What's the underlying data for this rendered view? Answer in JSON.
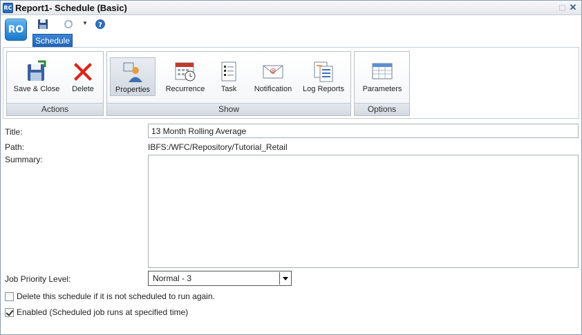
{
  "window": {
    "title": "Report1- Schedule (Basic)",
    "app_icon_text": "RC"
  },
  "quick_access": {
    "logo_text": "RO",
    "tab_label": "Schedule"
  },
  "ribbon": {
    "groups": {
      "actions": {
        "label": "Actions",
        "buttons": {
          "save_close": "Save & Close",
          "delete": "Delete"
        }
      },
      "show": {
        "label": "Show",
        "buttons": {
          "properties": "Properties",
          "recurrence": "Recurrence",
          "task": "Task",
          "notification": "Notification",
          "log_reports": "Log Reports"
        }
      },
      "options": {
        "label": "Options",
        "buttons": {
          "parameters": "Parameters"
        }
      }
    }
  },
  "form": {
    "title_label": "Title:",
    "title_value": "13 Month Rolling Average",
    "path_label": "Path:",
    "path_value": "IBFS:/WFC/Repository/Tutorial_Retail",
    "summary_label": "Summary:",
    "summary_value": "",
    "priority_label": "Job Priority Level:",
    "priority_value": "Normal - 3",
    "delete_checkbox_label": "Delete this schedule if it is not scheduled to run again.",
    "delete_checked": false,
    "enabled_checkbox_label": "Enabled (Scheduled job runs at specified time)",
    "enabled_checked": true
  },
  "colors": {
    "accent": "#1f63b4",
    "delete_red": "#d9251c"
  }
}
